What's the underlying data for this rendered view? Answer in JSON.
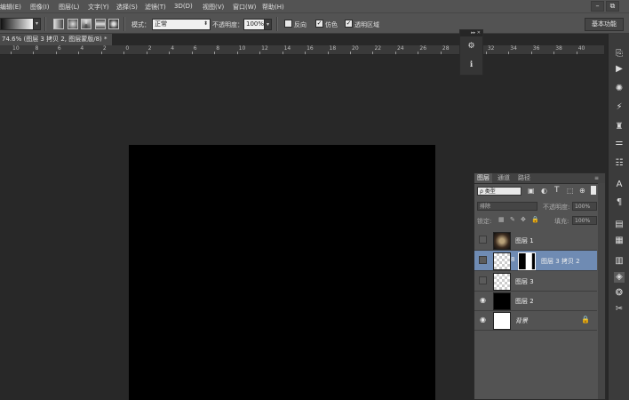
{
  "menubar": {
    "items": [
      "编辑(E)",
      "图像(I)",
      "图层(L)",
      "文字(Y)",
      "选择(S)",
      "滤镜(T)",
      "3D(D)",
      "视图(V)",
      "窗口(W)",
      "帮助(H)"
    ],
    "window_min": "–",
    "window_restore": "⧉"
  },
  "options": {
    "mode_label": "模式：",
    "mode_value": "正常",
    "opacity_label": "不透明度：",
    "opacity_value": "100%",
    "reverse_label": "反向",
    "dither_label": "仿色",
    "transparency_label": "透明区域",
    "workspace_label": "基本功能",
    "dither_checked": "✓",
    "transparency_checked": "✓"
  },
  "document": {
    "tab_title": "74.6% (图层 3 拷贝 2, 图层蒙版/8) *",
    "tab_close": "×",
    "ruler_labels": [
      "10",
      "8",
      "6",
      "4",
      "2",
      "0",
      "2",
      "4",
      "6",
      "8",
      "10",
      "12",
      "14",
      "16",
      "18",
      "20",
      "22",
      "24",
      "26",
      "28",
      "30",
      "32",
      "34",
      "36",
      "38",
      "40"
    ],
    "background_color": "#000000"
  },
  "layers_panel": {
    "tabs": [
      "图层",
      "通道",
      "路径"
    ],
    "filter_label": "ρ 类型",
    "blend_mode": "排除",
    "opacity_label": "不透明度:",
    "opacity_value": "100%",
    "lock_label": "锁定:",
    "fill_label": "填充:",
    "fill_value": "100%",
    "layers": [
      {
        "name": "图层 1",
        "visible": false,
        "thumb": "photo"
      },
      {
        "name": "图层 3 拷贝 2",
        "visible": false,
        "thumb": "checker-mask",
        "selected": true
      },
      {
        "name": "图层 3",
        "visible": false,
        "thumb": "checker"
      },
      {
        "name": "图层 2",
        "visible": true,
        "thumb": "black"
      },
      {
        "name": "背景",
        "visible": true,
        "thumb": "white",
        "locked": true
      }
    ]
  },
  "icons": {
    "eye": "👁",
    "lock": "🔒",
    "chain": "8"
  }
}
